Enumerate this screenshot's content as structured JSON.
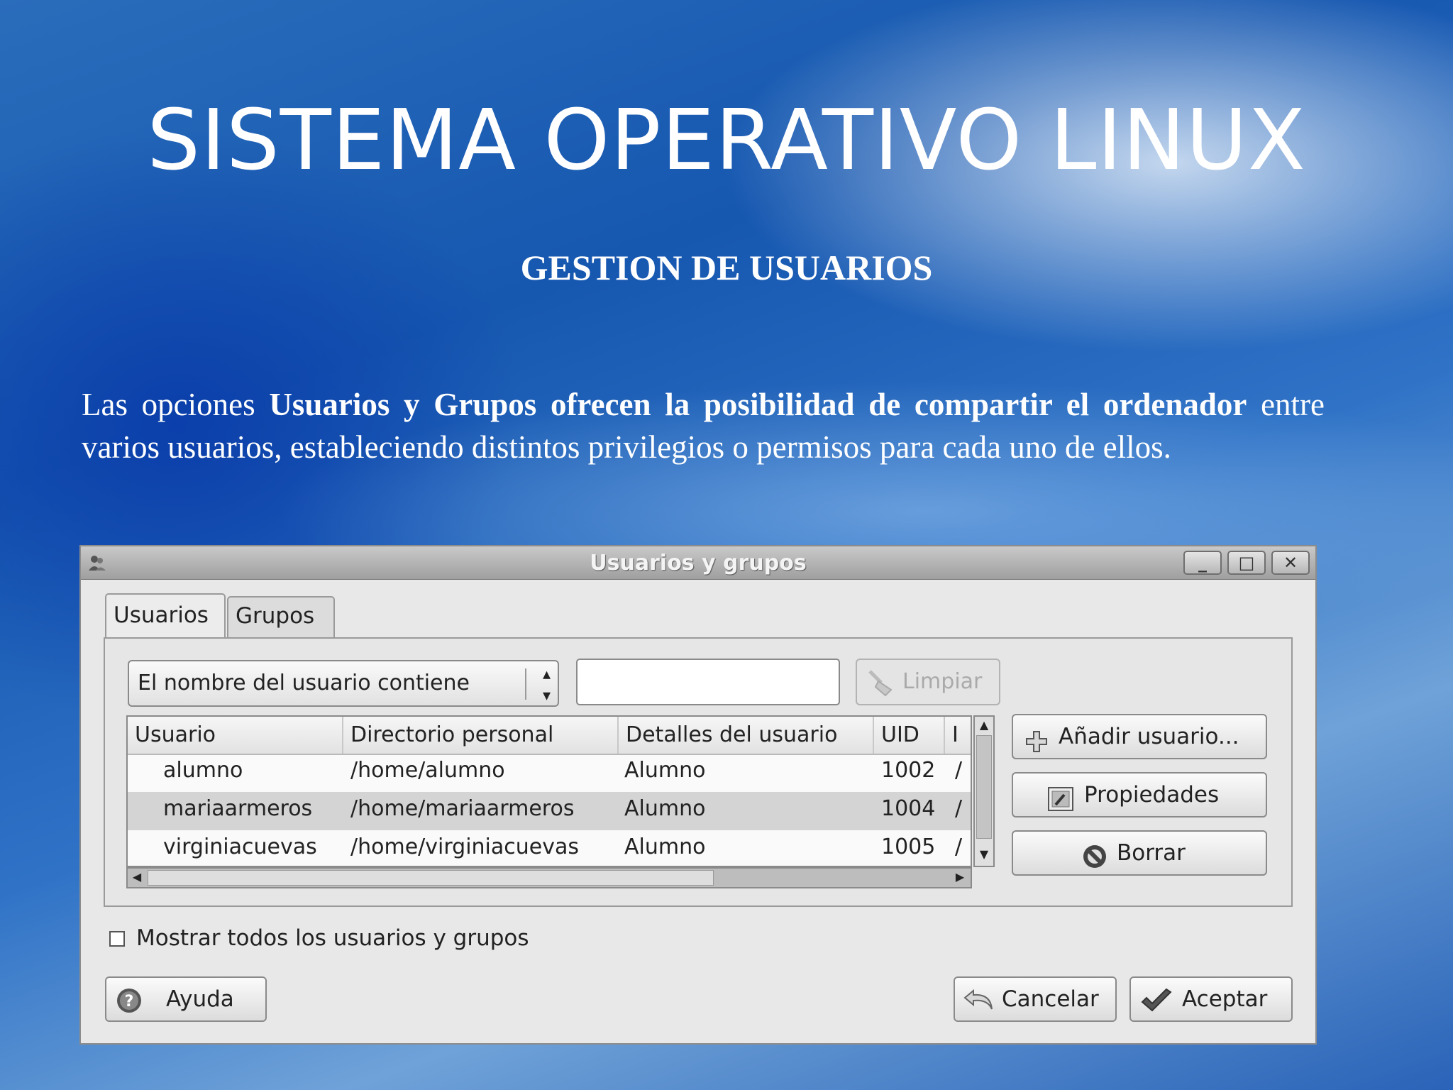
{
  "slide": {
    "title": "SISTEMA OPERATIVO LINUX",
    "subtitle": "GESTION DE USUARIOS",
    "paragraph": {
      "part1": "Las opciones ",
      "bold1": "Usuarios y Grupos ofrecen la posibilidad de compartir el ordenador",
      "part2": " entre varios usuarios, estableciendo distintos privilegios o permisos para cada uno de ellos."
    }
  },
  "window": {
    "title": "Usuarios y grupos",
    "controls": {
      "minimize": "_",
      "maximize": "□",
      "close": "✕"
    },
    "tabs": [
      "Usuarios",
      "Grupos"
    ],
    "filter": {
      "selected_option": "El nombre del usuario contiene",
      "search_value": "",
      "clear_label": "Limpiar"
    },
    "table": {
      "columns": [
        "Usuario",
        "Directorio personal",
        "Detalles del usuario",
        "UID",
        "I"
      ],
      "rows": [
        {
          "user": "alumno",
          "home": "/home/alumno",
          "details": "Alumno",
          "uid": "1002",
          "extra": "/"
        },
        {
          "user": "mariaarmeros",
          "home": "/home/mariaarmeros",
          "details": "Alumno",
          "uid": "1004",
          "extra": "/"
        },
        {
          "user": "virginiacuevas",
          "home": "/home/virginiacuevas",
          "details": "Alumno",
          "uid": "1005",
          "extra": "/"
        }
      ]
    },
    "actions": {
      "add": "Añadir usuario...",
      "properties": "Propiedades",
      "delete": "Borrar"
    },
    "show_all": {
      "label": "Mostrar todos los usuarios y grupos",
      "checked": false
    },
    "buttons": {
      "help": "Ayuda",
      "cancel": "Cancelar",
      "ok": "Aceptar"
    }
  }
}
